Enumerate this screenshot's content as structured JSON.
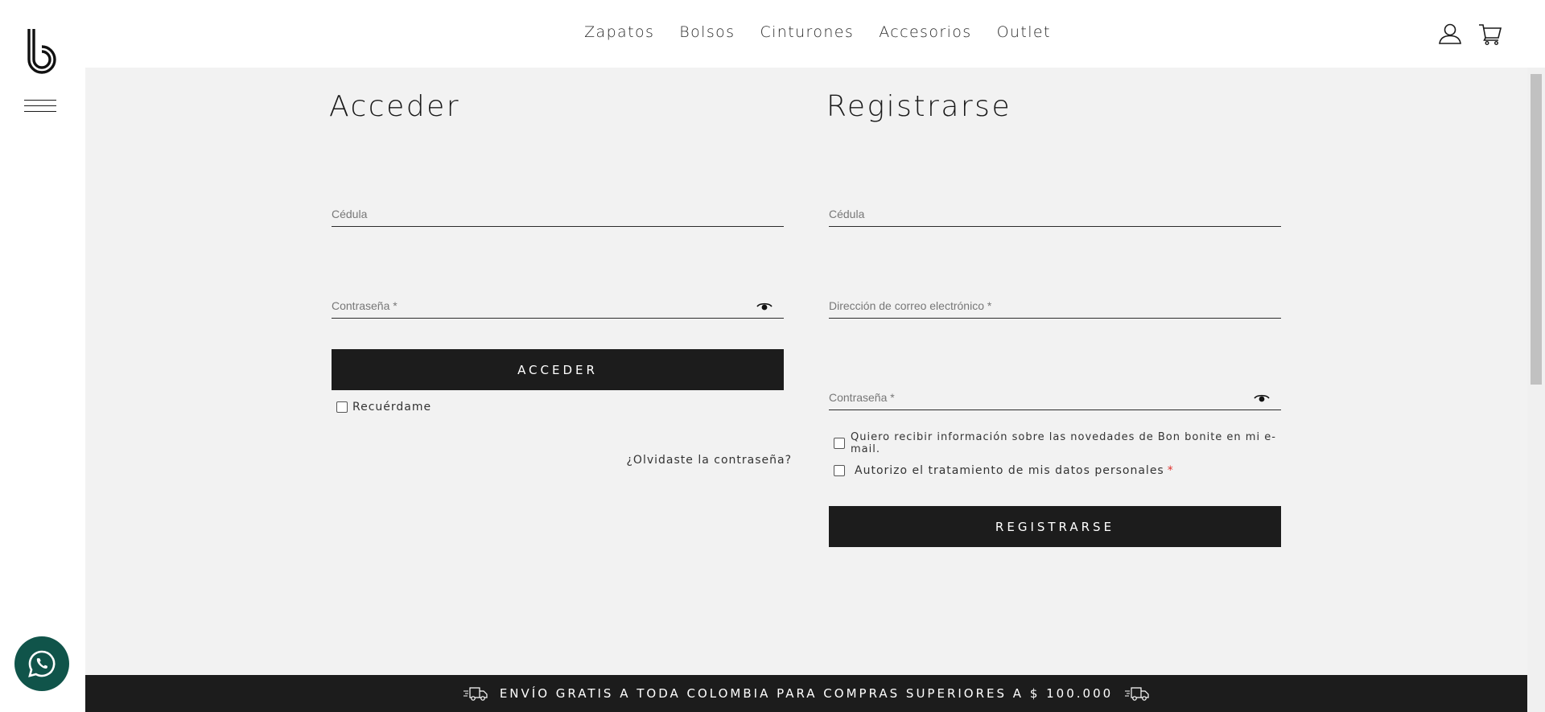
{
  "nav": {
    "items": [
      {
        "label": "Zapatos"
      },
      {
        "label": "Bolsos"
      },
      {
        "label": "Cinturones"
      },
      {
        "label": "Accesorios"
      },
      {
        "label": "Outlet"
      }
    ]
  },
  "header_icons": [
    "user-icon",
    "cart-icon"
  ],
  "login": {
    "title": "Acceder",
    "cedula_placeholder": "Cédula",
    "password_placeholder": "Contraseña *",
    "submit_label": "ACCEDER",
    "remember_label": "Recuérdame",
    "forgot_label": "¿Olvidaste la contraseña?"
  },
  "register": {
    "title": "Registrarse",
    "cedula_placeholder": "Cédula",
    "email_placeholder": "Dirección de correo electrónico *",
    "password_placeholder": "Contraseña *",
    "newsletter_label": "Quiero recibir información sobre las novedades de Bon bonite en mi e-mail.",
    "privacy_label": "Autorizo el tratamiento de mis datos personales",
    "privacy_required_mark": "*",
    "submit_label": "REGISTRARSE"
  },
  "promo": {
    "text": "ENVÍO GRATIS A TODA COLOMBIA PARA COMPRAS SUPERIORES A $ 100.000",
    "icon": "truck-icon"
  },
  "colors": {
    "button_bg": "#1c1c1c",
    "page_bg": "#f2f2f2",
    "whatsapp_bg": "#10544a",
    "required_mark": "#e0302c"
  }
}
